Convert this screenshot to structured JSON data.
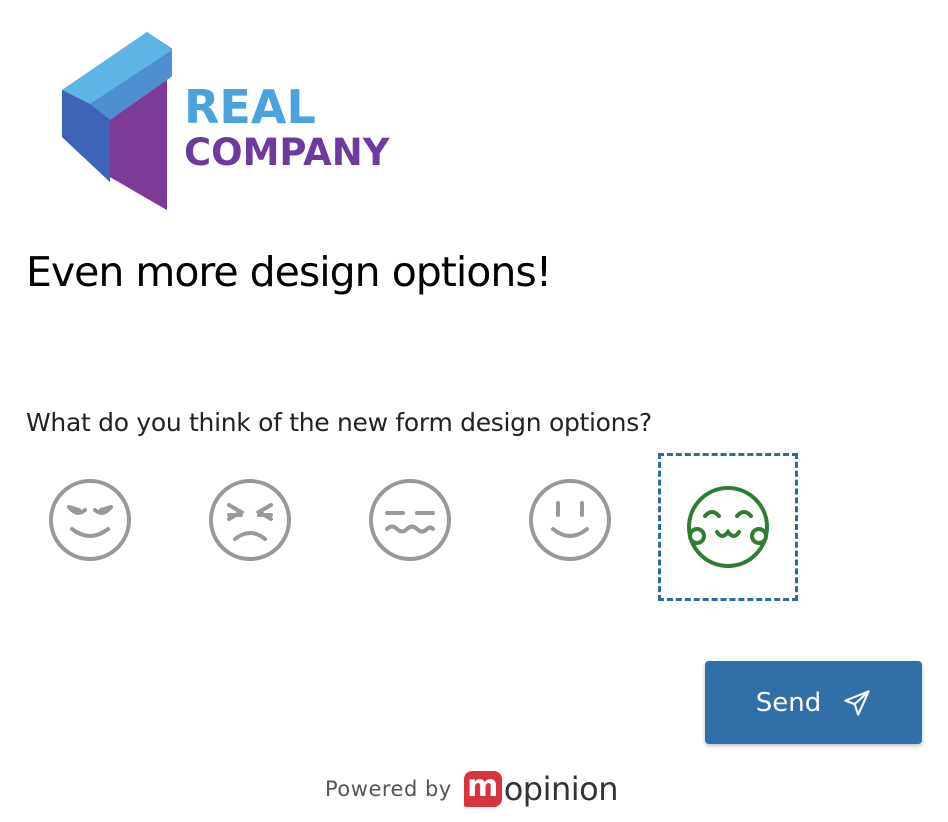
{
  "logo": {
    "line1": "REAL",
    "line2": "COMPANY"
  },
  "title": "Even more design options!",
  "question": "What do you think of the new form design options?",
  "rating": {
    "options": [
      {
        "icon": "smirk-face-icon",
        "selected": false
      },
      {
        "icon": "angry-squint-face-icon",
        "selected": false
      },
      {
        "icon": "nauseated-face-icon",
        "selected": false
      },
      {
        "icon": "smile-face-icon",
        "selected": false
      },
      {
        "icon": "blush-face-icon",
        "selected": true
      }
    ],
    "colors": {
      "unselected": "#999999",
      "selected": "#2e7d32",
      "focus": "#2b6aa6"
    }
  },
  "send": {
    "label": "Send",
    "icon": "paper-plane-icon",
    "color": "#306fa8"
  },
  "footer": {
    "powered_by": "Powered by",
    "brand_mark": "m",
    "brand_rest": "opinion"
  }
}
